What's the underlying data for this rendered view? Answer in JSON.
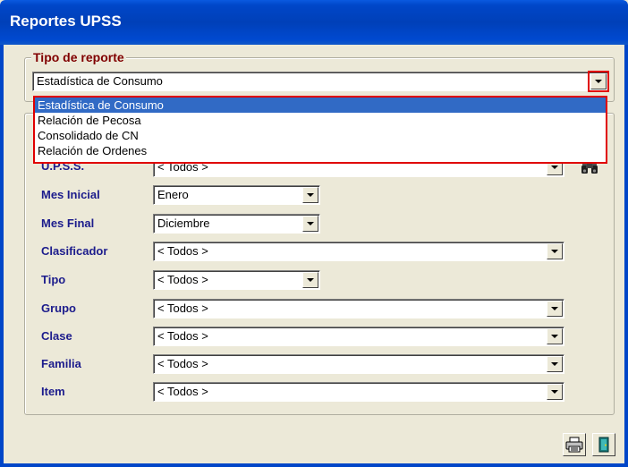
{
  "window": {
    "title": "Reportes UPSS"
  },
  "tipo_reporte": {
    "legend": "Tipo de reporte",
    "selected": "Estadística de Consumo",
    "options": [
      "Estadística de Consumo",
      "Relación de Pecosa",
      "Consolidado de CN",
      "Relación de Ordenes"
    ]
  },
  "filters": {
    "upss": {
      "label": "U.P.S.S.",
      "value": "< Todos >"
    },
    "mes_inicial": {
      "label": "Mes Inicial",
      "value": "Enero"
    },
    "mes_final": {
      "label": "Mes Final",
      "value": "Diciembre"
    },
    "clasificador": {
      "label": "Clasificador",
      "value": "< Todos >"
    },
    "tipo": {
      "label": "Tipo",
      "value": "< Todos >"
    },
    "grupo": {
      "label": "Grupo",
      "value": "< Todos >"
    },
    "clase": {
      "label": "Clase",
      "value": "< Todos >"
    },
    "familia": {
      "label": "Familia",
      "value": "< Todos >"
    },
    "item": {
      "label": "Item",
      "value": "< Todos >"
    }
  },
  "icons": {
    "find": "binoculars-icon",
    "print": "printer-icon",
    "exit": "exit-door-icon"
  },
  "colors": {
    "titlebar": "#0046c8",
    "label": "#1c1c8c",
    "legend": "#800000",
    "highlight": "#e00000",
    "selection": "#316ac5"
  }
}
